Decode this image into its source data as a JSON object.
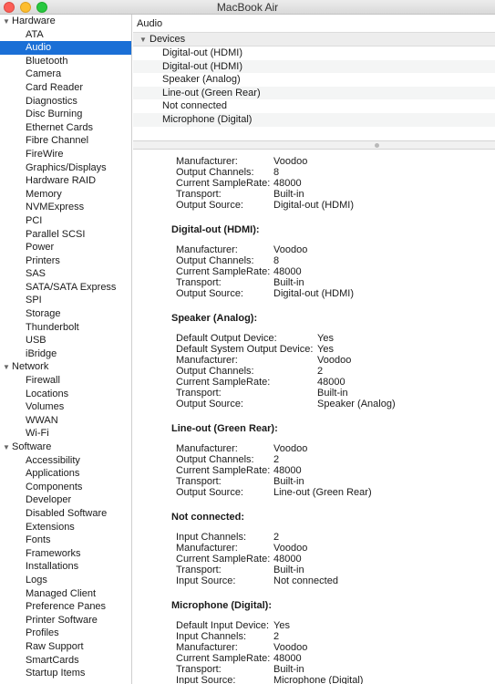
{
  "window": {
    "title": "MacBook Air"
  },
  "sidebar": {
    "sections": [
      {
        "label": "Hardware",
        "items": [
          "ATA",
          "Audio",
          "Bluetooth",
          "Camera",
          "Card Reader",
          "Diagnostics",
          "Disc Burning",
          "Ethernet Cards",
          "Fibre Channel",
          "FireWire",
          "Graphics/Displays",
          "Hardware RAID",
          "Memory",
          "NVMExpress",
          "PCI",
          "Parallel SCSI",
          "Power",
          "Printers",
          "SAS",
          "SATA/SATA Express",
          "SPI",
          "Storage",
          "Thunderbolt",
          "USB",
          "iBridge"
        ]
      },
      {
        "label": "Network",
        "items": [
          "Firewall",
          "Locations",
          "Volumes",
          "WWAN",
          "Wi-Fi"
        ]
      },
      {
        "label": "Software",
        "items": [
          "Accessibility",
          "Applications",
          "Components",
          "Developer",
          "Disabled Software",
          "Extensions",
          "Fonts",
          "Frameworks",
          "Installations",
          "Logs",
          "Managed Client",
          "Preference Panes",
          "Printer Software",
          "Profiles",
          "Raw Support",
          "SmartCards",
          "Startup Items"
        ]
      }
    ],
    "selected": "Audio"
  },
  "content": {
    "breadcrumb": "Audio",
    "devices_header": "Devices",
    "devices": [
      "Digital-out (HDMI)",
      "Digital-out (HDMI)",
      "Speaker (Analog)",
      "Line-out (Green Rear)",
      "Not connected",
      "Microphone (Digital)"
    ],
    "details": [
      {
        "title": "",
        "value_col": "Voodoo",
        "rows": [
          [
            "Manufacturer:",
            "Voodoo"
          ],
          [
            "Output Channels:",
            "8"
          ],
          [
            "Current SampleRate:",
            "48000"
          ],
          [
            "Transport:",
            "Built-in"
          ],
          [
            "Output Source:",
            "Digital-out (HDMI)"
          ]
        ]
      },
      {
        "title": "Digital-out (HDMI):",
        "rows": [
          [
            "Manufacturer:",
            "Voodoo"
          ],
          [
            "Output Channels:",
            "8"
          ],
          [
            "Current SampleRate:",
            "48000"
          ],
          [
            "Transport:",
            "Built-in"
          ],
          [
            "Output Source:",
            "Digital-out (HDMI)"
          ]
        ]
      },
      {
        "title": "Speaker (Analog):",
        "rows": [
          [
            "Default Output Device:",
            "Yes"
          ],
          [
            "Default System Output Device:",
            "Yes"
          ],
          [
            "Manufacturer:",
            "Voodoo"
          ],
          [
            "Output Channels:",
            "2"
          ],
          [
            "Current SampleRate:",
            "48000"
          ],
          [
            "Transport:",
            "Built-in"
          ],
          [
            "Output Source:",
            "Speaker (Analog)"
          ]
        ]
      },
      {
        "title": "Line-out (Green Rear):",
        "rows": [
          [
            "Manufacturer:",
            "Voodoo"
          ],
          [
            "Output Channels:",
            "2"
          ],
          [
            "Current SampleRate:",
            "48000"
          ],
          [
            "Transport:",
            "Built-in"
          ],
          [
            "Output Source:",
            "Line-out (Green Rear)"
          ]
        ]
      },
      {
        "title": "Not connected:",
        "rows": [
          [
            "Input Channels:",
            "2"
          ],
          [
            "Manufacturer:",
            "Voodoo"
          ],
          [
            "Current SampleRate:",
            "48000"
          ],
          [
            "Transport:",
            "Built-in"
          ],
          [
            "Input Source:",
            "Not connected"
          ]
        ]
      },
      {
        "title": "Microphone (Digital):",
        "rows": [
          [
            "Default Input Device:",
            "Yes"
          ],
          [
            "Input Channels:",
            "2"
          ],
          [
            "Manufacturer:",
            "Voodoo"
          ],
          [
            "Current SampleRate:",
            "48000"
          ],
          [
            "Transport:",
            "Built-in"
          ],
          [
            "Input Source:",
            "Microphone (Digital)"
          ]
        ]
      }
    ]
  },
  "colors": {
    "selection": "#1a6fd6",
    "close": "#fc5f57",
    "minimize": "#fdbd2e",
    "zoom": "#28c840"
  }
}
